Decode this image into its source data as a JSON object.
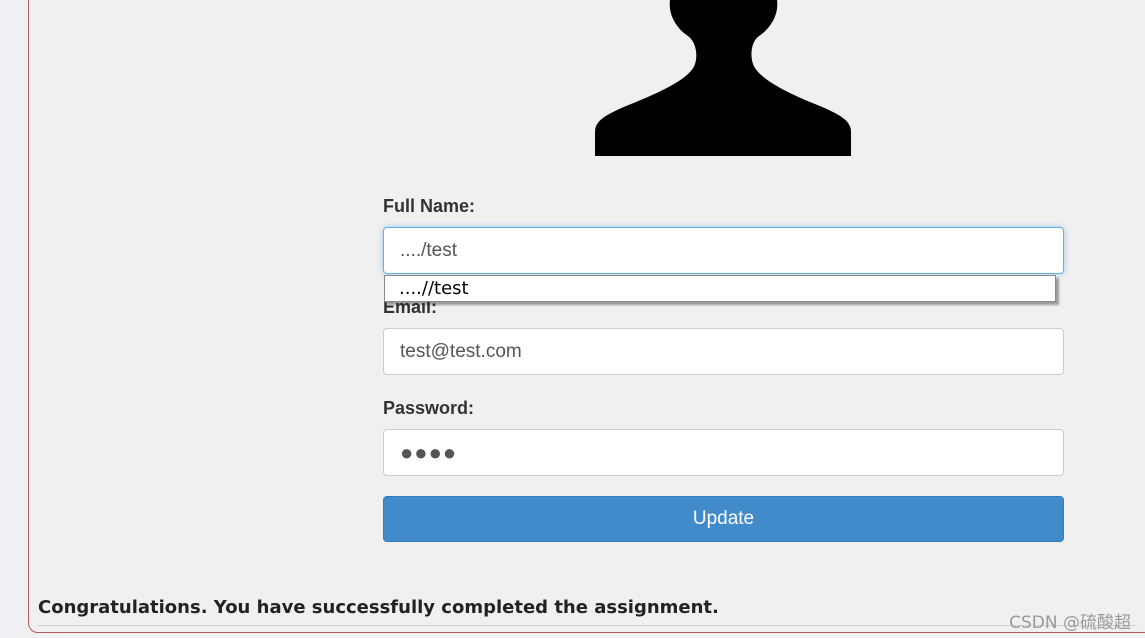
{
  "form": {
    "avatar_icon": "person-silhouette-icon",
    "full_name": {
      "label": "Full Name:",
      "value": "..../test"
    },
    "autocomplete": {
      "suggestion": "....//test"
    },
    "email": {
      "label": "Email:",
      "value": "test@test.com"
    },
    "password": {
      "label": "Password:",
      "value": "●●●●"
    },
    "update_button": {
      "label": "Update",
      "color": "#428bca"
    }
  },
  "feedback": {
    "message": "Congratulations. You have successfully completed the assignment."
  },
  "watermark": {
    "text": "CSDN @硫酸超"
  }
}
